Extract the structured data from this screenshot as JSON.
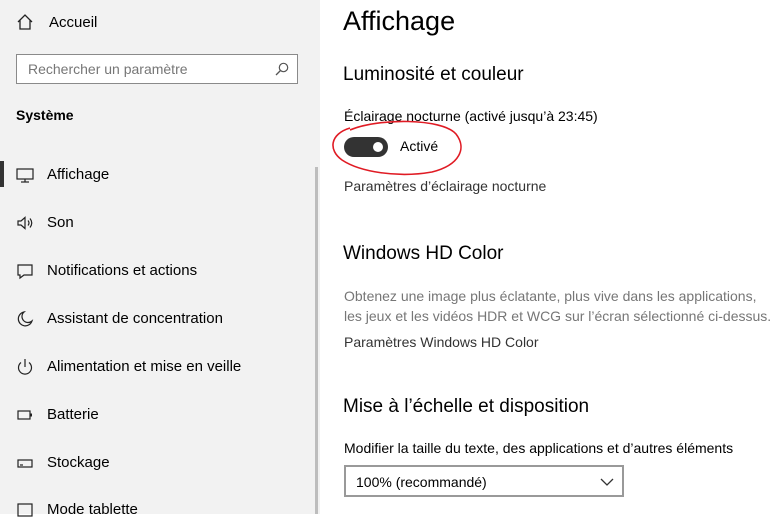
{
  "sidebar": {
    "home_label": "Accueil",
    "search_placeholder": "Rechercher un paramètre",
    "section_title": "Système",
    "items": [
      {
        "label": "Affichage",
        "icon": "monitor-icon",
        "active": true
      },
      {
        "label": "Son",
        "icon": "speaker-icon"
      },
      {
        "label": "Notifications et actions",
        "icon": "notification-icon"
      },
      {
        "label": "Assistant de concentration",
        "icon": "moon-icon"
      },
      {
        "label": "Alimentation et mise en veille",
        "icon": "power-icon"
      },
      {
        "label": "Batterie",
        "icon": "battery-icon"
      },
      {
        "label": "Stockage",
        "icon": "storage-icon"
      },
      {
        "label": "Mode tablette",
        "icon": "tablet-icon"
      }
    ]
  },
  "main": {
    "title": "Affichage",
    "brightness": {
      "heading": "Luminosité et couleur",
      "night_light_label": "Éclairage nocturne (activé jusqu’à 23:45)",
      "toggle_state": "Activé",
      "toggle_on": true,
      "settings_link": "Paramètres d’éclairage nocturne"
    },
    "hd": {
      "heading": "Windows HD Color",
      "description_line1": "Obtenez une image plus éclatante, plus vive dans les applications,",
      "description_line2": "les jeux et les vidéos HDR et WCG sur l’écran sélectionné ci-dessus.",
      "settings_link": "Paramètres Windows HD Color"
    },
    "scale": {
      "heading": "Mise à l’échelle et disposition",
      "size_label": "Modifier la taille du texte, des applications et d’autres éléments",
      "dropdown_value": "100% (recommandé)"
    }
  },
  "colors": {
    "sidebar_bg": "#f2f2f2",
    "toggle_on": "#333333",
    "annotation": "#e01b24"
  }
}
